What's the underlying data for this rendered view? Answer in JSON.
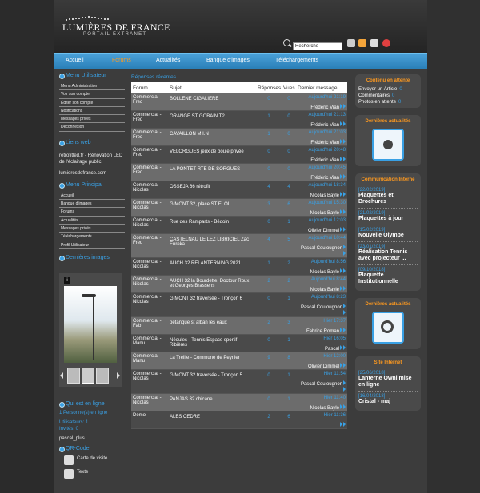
{
  "header": {
    "logo_main": "LUMIÈRES DE FRANCE",
    "logo_sub": "PORTAIL EXTRANET",
    "search_value": "Recherche"
  },
  "nav": [
    {
      "label": "Accueil",
      "active": false
    },
    {
      "label": "Forums",
      "active": true
    },
    {
      "label": "Actualités",
      "active": false
    },
    {
      "label": "Banque d'images",
      "active": false
    },
    {
      "label": "Téléchargements",
      "active": false
    }
  ],
  "left": {
    "menu_user_title": "Menu Utilisateur",
    "menu_user": [
      "Menu Administration",
      "Voir son compte",
      "Éditer son compte",
      "Notifications",
      "Messages privés",
      "Déconnexion"
    ],
    "links_title": "Liens web",
    "links": [
      "retrofitled.fr - Rénovation LED de l'éclairage public",
      "lumieresdefrance.com"
    ],
    "menu_main_title": "Menu Principal",
    "menu_main": [
      "Accueil",
      "Banque d'images",
      "Forums",
      "Actualités",
      "Messages privés",
      "Téléchargements",
      "Profil Utilisateur"
    ],
    "images_title": "Dernières images",
    "online_title": "Qui est en ligne",
    "online_count": "1 Personne(s) en ligne",
    "users": "Utilisateurs: 1",
    "guests": "Invités: 0",
    "online_user": "pascal_plus...",
    "qr_title": "QR-Code",
    "qr_items": [
      "Carte de visite",
      "Texte"
    ]
  },
  "forum": {
    "title": "Réponses récentes",
    "headers": [
      "Forum",
      "Sujet",
      "Réponses",
      "Vues",
      "Dernier message"
    ],
    "rows": [
      {
        "forum": "Commercial - Fred",
        "subject": "BOLLENE CIGALIERE",
        "replies": "0",
        "views": "0",
        "date": "Aujourd'hui 21:19",
        "user": "Frédéric Vian"
      },
      {
        "forum": "Commercial - Fred",
        "subject": "ORANGE ST GOBAIN T2",
        "replies": "1",
        "views": "0",
        "date": "Aujourd'hui 21:13",
        "user": "Frédéric Vian"
      },
      {
        "forum": "Commercial - Fred",
        "subject": "CAVAILLON M.I.N",
        "replies": "1",
        "views": "0",
        "date": "Aujourd'hui 21:03",
        "user": "Frédéric Vian"
      },
      {
        "forum": "Commercial - Fred",
        "subject": "VELORGUES jeux de boule privée",
        "replies": "0",
        "views": "0",
        "date": "Aujourd'hui 20:48",
        "user": "Frédéric Vian"
      },
      {
        "forum": "Commercial - Fred",
        "subject": "LA PONTET RTE DE SORGUES",
        "replies": "0",
        "views": "0",
        "date": "Aujourd'hui 20:45",
        "user": "Frédéric Vian"
      },
      {
        "forum": "Commercial - Nicolas",
        "subject": "OSSEJA 66 rétrofit",
        "replies": "4",
        "views": "4",
        "date": "Aujourd'hui 18:34",
        "user": "Nicolas Bayle"
      },
      {
        "forum": "Commercial - Nicolas",
        "subject": "GIMONT 32, place ST ELOI",
        "replies": "3",
        "views": "6",
        "date": "Aujourd'hui 15:30",
        "user": "Nicolas Bayle"
      },
      {
        "forum": "Commercial - Nicolas",
        "subject": "Rue des Ramparts - Bédoin",
        "replies": "0",
        "views": "1",
        "date": "Aujourd'hui 12:03",
        "user": "Olivier Dimmel"
      },
      {
        "forum": "Commercial - Fred",
        "subject": "CASTELNAU LE LEZ LIBRICIEL Zac Eureka",
        "replies": "4",
        "views": "5",
        "date": "Aujourd'hui 10:44",
        "user": "Pascal Coulougnon"
      },
      {
        "forum": "Commercial - Nicolas",
        "subject": "AUCH 32 RELANTERNING 2021",
        "replies": "1",
        "views": "2",
        "date": "Aujourd'hui 8:56",
        "user": "Nicolas Bayle"
      },
      {
        "forum": "Commercial - Nicolas",
        "subject": "AUCH 32 la Bourdette, Doctour Roux et Georges Brassens",
        "replies": "2",
        "views": "2",
        "date": "Aujourd'hui 8:44",
        "user": "Nicolas Bayle"
      },
      {
        "forum": "Commercial - Nicolas",
        "subject": "GIMONT 32 traversée - Tronçon 6",
        "replies": "0",
        "views": "1",
        "date": "Aujourd'hui 8:23",
        "user": "Pascal Coulougnon"
      },
      {
        "forum": "Commercial - Fab",
        "subject": "petanque st alban les eaux",
        "replies": "2",
        "views": "3",
        "date": "Hier 17:37",
        "user": "Fabrice Roman"
      },
      {
        "forum": "Commercial - Manu",
        "subject": "Néoules - Tennis Espace sportif Ribières",
        "replies": "0",
        "views": "1",
        "date": "Hier 16:05",
        "user": "Pascal"
      },
      {
        "forum": "Commercial - Manu",
        "subject": "La Treille - Commune de Peynier",
        "replies": "9",
        "views": "8",
        "date": "Hier 12:00",
        "user": "Olivier Dimmel"
      },
      {
        "forum": "Commercial - Nicolas",
        "subject": "GIMONT 32 traversée - Tronçon 5",
        "replies": "0",
        "views": "1",
        "date": "Hier 11:54",
        "user": "Pascal Coulougnon"
      },
      {
        "forum": "Commercial - Nicolas",
        "subject": "PANJAS 32 chicane",
        "replies": "0",
        "views": "1",
        "date": "Hier 11:40",
        "user": "Nicolas Bayle"
      },
      {
        "forum": "Démo",
        "subject": "ALES CEDRE",
        "replies": "2",
        "views": "6",
        "date": "Hier 11:36",
        "user": ""
      }
    ]
  },
  "right": {
    "pending_title": "Contenu en attente",
    "pending": [
      {
        "label": "Envoyer un Article",
        "count": "0"
      },
      {
        "label": "Commentaires",
        "count": "0"
      },
      {
        "label": "Photos en attente",
        "count": "0"
      }
    ],
    "news1_title": "Dernières actualités",
    "comm_title": "Communication Interne",
    "comm": [
      {
        "date": "[22/02/2019]",
        "title": "Plaquettes et Brochures"
      },
      {
        "date": "[21/02/2019]",
        "title": "Plaquettes à jour"
      },
      {
        "date": "[15/02/2019]",
        "title": "Nouvelle Olympe"
      },
      {
        "date": "[23/01/2019]",
        "title": "Réalisation Tennis avec projecteur ..."
      },
      {
        "date": "[09/10/2018]",
        "title": "Plaquette Institutionnelle"
      }
    ],
    "news2_title": "Dernières actualités",
    "site_title": "Site Internet",
    "site": [
      {
        "date": "[25/06/2018]",
        "title": "Lanterne Owni mise en ligne"
      },
      {
        "date": "[16/04/2018]",
        "title": "Cristal - maj"
      }
    ]
  }
}
